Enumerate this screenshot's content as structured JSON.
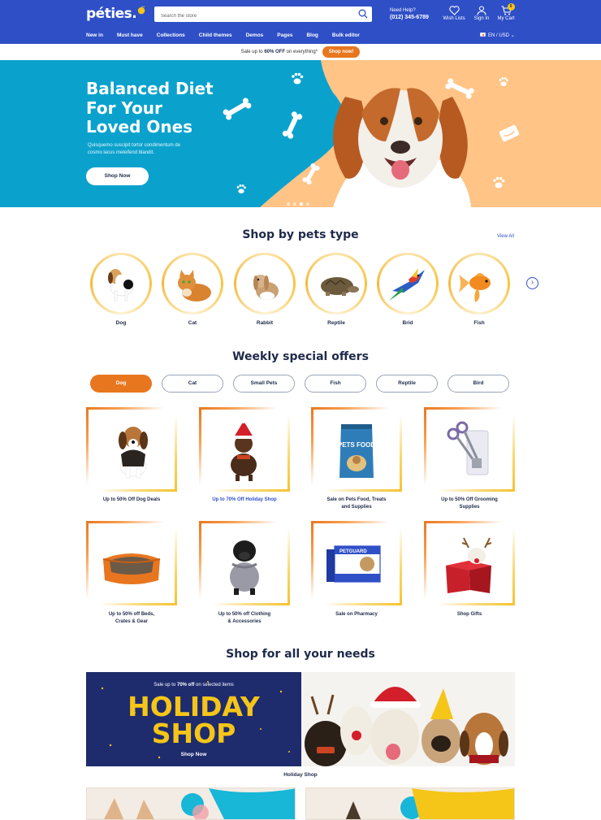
{
  "header": {
    "logo": "péties.",
    "search_placeholder": "Search the store",
    "help_label": "Need Help?",
    "help_phone": "(012) 345-6789",
    "wishlist": "Wish Lists",
    "signin": "Sign In",
    "cart": "My Cart",
    "cart_count": "0",
    "nav": [
      "New in",
      "Must have",
      "Collections",
      "Child themes",
      "Demos",
      "Pages",
      "Blog",
      "Bulk editor"
    ],
    "lang": "EN / USD"
  },
  "promo": {
    "prefix": "Sale up to",
    "highlight": "60% OFF",
    "suffix": "on everything*",
    "button": "Shop now!"
  },
  "hero": {
    "title_lines": [
      "Balanced Diet",
      "For Your",
      "Loved Ones"
    ],
    "subtitle": "Quisquemo suscipit tortor condimentum de cosmo lacus meleifend blandit.",
    "button": "Shop Now",
    "slides": 4,
    "active_slide": 2
  },
  "pets_section": {
    "title": "Shop by pets type",
    "view_all": "View All",
    "items": [
      "Dog",
      "Cat",
      "Rabbit",
      "Reptile",
      "Brid",
      "Fish"
    ]
  },
  "offers_section": {
    "title": "Weekly special offers",
    "tabs": [
      "Dog",
      "Cat",
      "Small Pets",
      "Fish",
      "Reptile",
      "Bird"
    ],
    "active_tab": "Dog",
    "cards": [
      [
        "Up to 50% Off Dog Deals"
      ],
      [
        "Up to 70% Off Holiday Shop"
      ],
      [
        "Sale on Pets Food, Treats",
        "and Supplies"
      ],
      [
        "Up to 50% Off Grooming",
        "Supplies"
      ],
      [
        "Up to 50% off Beds,",
        "Crates & Gear"
      ],
      [
        "Up to 50% off Clothing",
        "& Accessories"
      ],
      [
        "Sale on Pharmacy"
      ],
      [
        "Shop Gifts"
      ]
    ],
    "food_bag_text": "PETS FOOD",
    "pharmacy_box_text": "PETGUARD"
  },
  "needs_section": {
    "title": "Shop for all your needs",
    "banner_small_prefix": "Sale up to",
    "banner_small_highlight": "70% off",
    "banner_small_suffix": "on selected items",
    "banner_big": [
      "HOLIDAY",
      "SHOP"
    ],
    "banner_button": "Shop Now",
    "banner_label": "Holiday Shop"
  },
  "colors": {
    "primary_blue": "#2f4fc7",
    "accent_orange": "#e8761e",
    "hero_cyan": "#0aa2cc",
    "hero_peach": "#ffc486",
    "yellow": "#f5c518",
    "navy_text": "#1f2a4a"
  }
}
